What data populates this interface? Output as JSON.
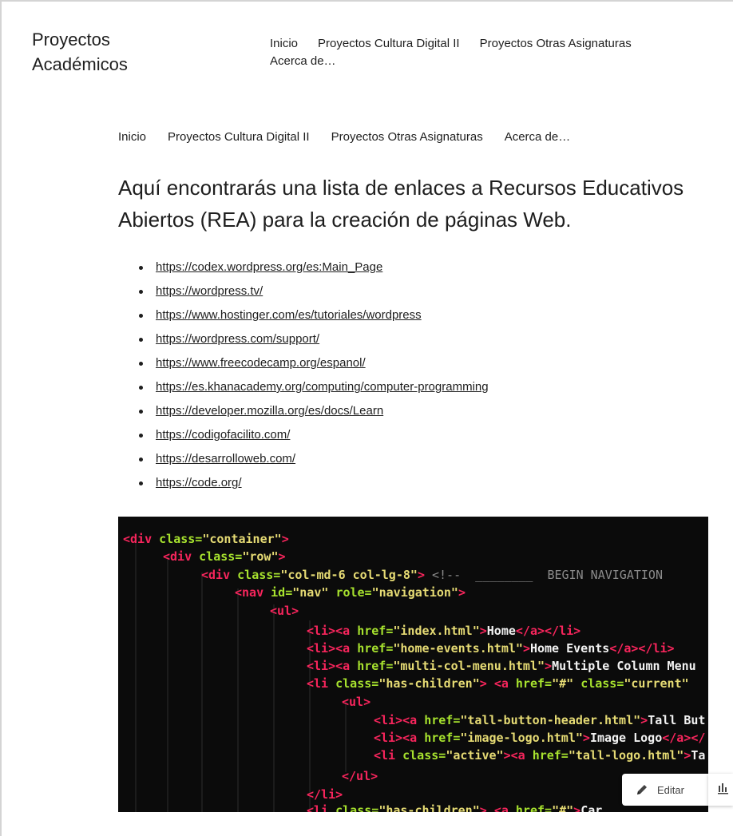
{
  "site": {
    "title_line1": "Proyectos",
    "title_line2": "Académicos"
  },
  "top_nav": [
    "Inicio",
    "Proyectos Cultura Digital II",
    "Proyectos Otras Asignaturas",
    "Acerca de…"
  ],
  "sub_nav": [
    "Inicio",
    "Proyectos Cultura Digital II",
    "Proyectos Otras Asignaturas",
    "Acerca de…"
  ],
  "heading": "Aquí encontrarás una lista de enlaces a Recursos Educativos Abiertos (REA) para la creación de páginas Web.",
  "links": [
    "https://codex.wordpress.org/es:Main_Page",
    "https://wordpress.tv/",
    "https://www.hostinger.com/es/tutoriales/wordpress",
    "https://wordpress.com/support/",
    "https://www.freecodecamp.org/espanol/",
    "https://es.khanacademy.org/computing/computer-programming",
    "https://developer.mozilla.org/es/docs/Learn",
    "https://codigofacilito.com/",
    "https://desarrolloweb.com/",
    "https://code.org/"
  ],
  "edit_button": {
    "label": "Editar",
    "icon": "pencil-icon"
  },
  "stats_button": {
    "icon": "bar-chart-icon"
  },
  "colors": {
    "text": "#1e1e1e",
    "code_bg": "#0b0b0b",
    "tag": "#f7255c",
    "attr": "#a7e22e",
    "string": "#e6db74"
  }
}
